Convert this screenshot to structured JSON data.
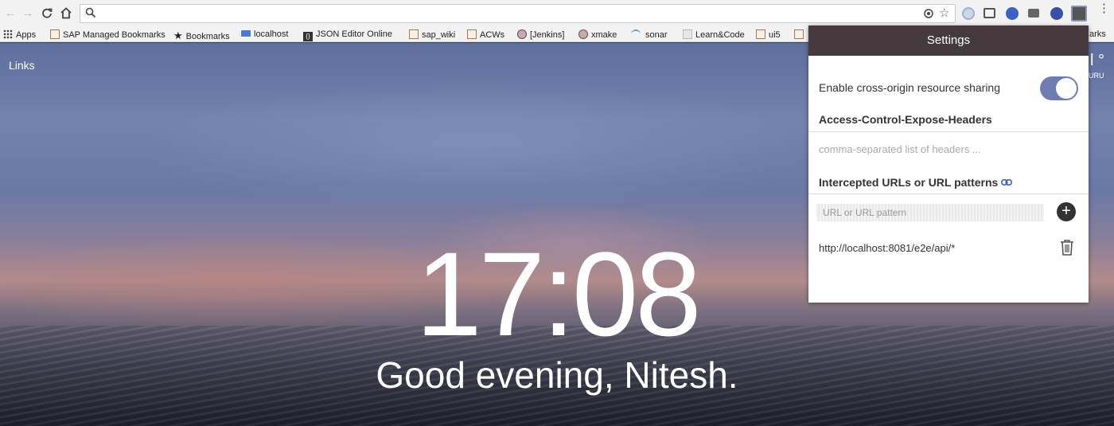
{
  "browser": {
    "address_value": "",
    "bookmarks": [
      {
        "label": "Apps",
        "icon": "apps-grid-icon"
      },
      {
        "label": "SAP Managed Bookmarks",
        "icon": "folder-icon"
      },
      {
        "label": "Bookmarks",
        "icon": "star-icon"
      },
      {
        "label": "localhost",
        "icon": "bookmark-page-icon"
      },
      {
        "label": "JSON Editor Online",
        "icon": "json-icon"
      },
      {
        "label": "sap_wiki",
        "icon": "bookmark-page-icon"
      },
      {
        "label": "ACWs",
        "icon": "bookmark-page-icon"
      },
      {
        "label": "[Jenkins]",
        "icon": "jenkins-icon"
      },
      {
        "label": "xmake",
        "icon": "jenkins-icon"
      },
      {
        "label": "sonar",
        "icon": "sonar-icon"
      },
      {
        "label": "Learn&Code",
        "icon": "bookmark-page-icon"
      },
      {
        "label": "ui5",
        "icon": "bookmark-page-icon"
      },
      {
        "label": "arks",
        "icon": "bookmark-page-icon"
      }
    ]
  },
  "page": {
    "links_label": "Links",
    "weather_degree": "l °",
    "weather_location": "URU",
    "time": "17:08",
    "greeting": "Good evening, Nitesh."
  },
  "settings": {
    "title": "Settings",
    "cors_label": "Enable cross-origin resource sharing",
    "cors_enabled": true,
    "expose_headers_title": "Access-Control-Expose-Headers",
    "expose_headers_placeholder": "comma-separated list of headers ...",
    "intercepted_title": "Intercepted URLs or URL patterns",
    "url_placeholder": "URL or URL pattern",
    "urls": [
      "http://localhost:8081/e2e/api/*"
    ]
  },
  "colors": {
    "popup_header": "#453b3f",
    "toggle_on": "#6f7cb2"
  }
}
